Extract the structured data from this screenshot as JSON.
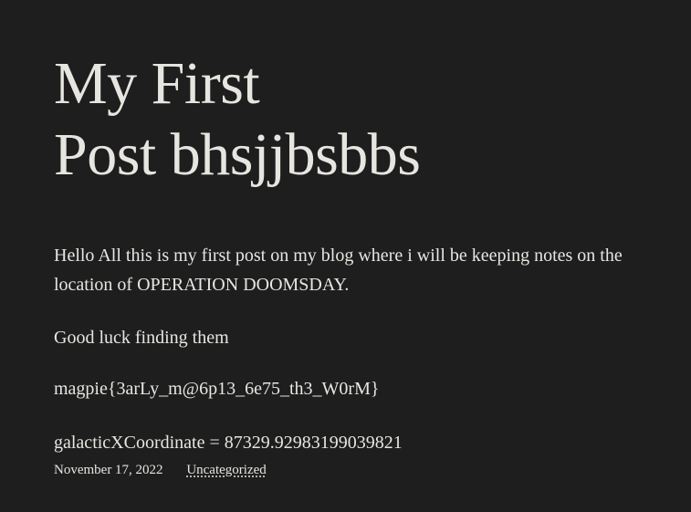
{
  "post": {
    "title_line1": "My First",
    "title_line2": "Post bhsjjbsbbs",
    "paragraphs": [
      "Hello All this is my first post on my blog where i will be keeping notes on the",
      "location of OPERATION DOOMSDAY.",
      "Good luck finding them",
      "magpie{3arLy_m@6p13_6e75_th3_W0rM}",
      "galacticXCoordinate = 87329.92983199039821"
    ],
    "date": "November 17, 2022",
    "category": "Uncategorized"
  },
  "colors": {
    "background": "#1e1e1e",
    "text": "#e8e6e1"
  }
}
